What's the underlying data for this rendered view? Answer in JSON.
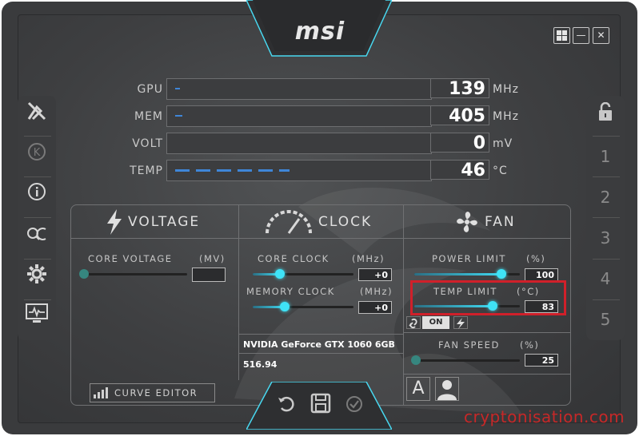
{
  "brand": {
    "logo": "msi"
  },
  "window_controls": {
    "windows_icon": "windows-icon",
    "minimize": "—",
    "close": "✕"
  },
  "monitor": [
    {
      "label": "GPU",
      "value": "139",
      "unit": "MHz",
      "fraction": 0.02
    },
    {
      "label": "MEM",
      "value": "405",
      "unit": "MHz",
      "fraction": 0.03
    },
    {
      "label": "VOLT",
      "value": "0",
      "unit": "mV",
      "fraction": 0.0
    },
    {
      "label": "TEMP",
      "value": "46",
      "unit": "°C",
      "fraction": 0.46
    }
  ],
  "left_sidebar": [
    "overclock-scanner-icon",
    "kombustor-icon",
    "info-icon",
    "oc-scanner-icon",
    "settings-icon",
    "monitor-icon"
  ],
  "right_sidebar": {
    "lock_icon": "unlock-icon",
    "profiles": [
      "1",
      "2",
      "3",
      "4",
      "5"
    ]
  },
  "voltage": {
    "title": "VOLTAGE",
    "core_voltage_label": "CORE VOLTAGE",
    "core_voltage_unit": "(MV)",
    "core_voltage_value": "",
    "curve_editor": "CURVE EDITOR"
  },
  "clock": {
    "title": "CLOCK",
    "core_clock_label": "CORE CLOCK",
    "core_clock_unit": "(MHz)",
    "core_clock_value": "+0",
    "memory_clock_label": "MEMORY CLOCK",
    "memory_clock_unit": "(MHz)",
    "memory_clock_value": "+0",
    "gpu_name": "NVIDIA GeForce GTX 1060 6GB",
    "driver": "516.94"
  },
  "fan": {
    "title": "FAN",
    "power_limit_label": "POWER LIMIT",
    "power_limit_unit": "(%)",
    "power_limit_value": "100",
    "temp_limit_label": "TEMP LIMIT",
    "temp_limit_unit": "(°C)",
    "temp_limit_value": "83",
    "link_on": "ON",
    "fan_speed_label": "FAN SPEED",
    "fan_speed_unit": "(%)",
    "fan_speed_value": "25",
    "auto_label": "A"
  },
  "bottom_actions": [
    "reset-icon",
    "save-icon",
    "apply-icon"
  ],
  "watermark": "cryptonisation.com",
  "colors": {
    "accent": "#3fe3f7",
    "highlight": "#d0202a",
    "frame": "#3a3b3d"
  }
}
